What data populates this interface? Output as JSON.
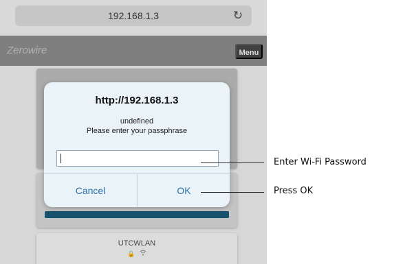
{
  "browser": {
    "url": "192.168.1.3",
    "reload_icon": "reload-icon"
  },
  "app": {
    "title": "Zerowire",
    "menu_label": "Menu"
  },
  "network_list": {
    "item_name": "UTCWLAN",
    "item_icons": [
      "lock-icon",
      "wifi-icon"
    ]
  },
  "dialog": {
    "title": "http://192.168.1.3",
    "message_line1": "undefined",
    "message_line2": "Please enter your passphrase",
    "input_value": "",
    "cancel_label": "Cancel",
    "ok_label": "OK"
  },
  "annotations": {
    "input_callout": "Enter Wi-Fi Password",
    "ok_callout": "Press OK"
  },
  "colors": {
    "dialog_button_text": "#2a6fa8",
    "card_accent": "#16516e",
    "app_header": "#7f7f7f"
  }
}
